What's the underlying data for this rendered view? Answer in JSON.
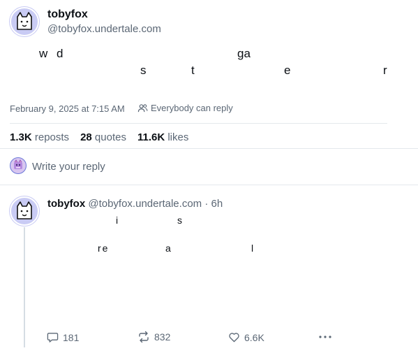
{
  "post": {
    "author": {
      "display_name": "tobyfox",
      "handle": "@tobyfox.undertale.com"
    },
    "text_chars": [
      {
        "char": "w",
        "line": 1
      },
      {
        "char": "d",
        "line": 1
      },
      {
        "char": "ga",
        "line": 1
      },
      {
        "char": "s",
        "line": 2
      },
      {
        "char": "t",
        "line": 2
      },
      {
        "char": "e",
        "line": 2
      },
      {
        "char": "r",
        "line": 2
      }
    ],
    "timestamp": "February 9, 2025 at 7:15 AM",
    "reply_setting": "Everybody can reply",
    "stats": {
      "reposts_count": "1.3K",
      "reposts_label": "reposts",
      "quotes_count": "28",
      "quotes_label": "quotes",
      "likes_count": "11.6K",
      "likes_label": "likes"
    }
  },
  "reply_box": {
    "placeholder": "Write your reply"
  },
  "reply": {
    "author": {
      "display_name": "tobyfox",
      "handle": "@tobyfox.undertale.com",
      "time": "6h"
    },
    "text_chars": [
      {
        "char": "i",
        "line": 1
      },
      {
        "char": "s",
        "line": 1
      },
      {
        "char": "re",
        "line": 2
      },
      {
        "char": "a",
        "line": 2
      },
      {
        "char": "l",
        "line": 2
      }
    ],
    "actions": {
      "replies": "181",
      "reposts": "832",
      "likes": "6.6K"
    }
  },
  "icons": {
    "avatar": "cat-face-icon",
    "reply_setting": "people-icon",
    "reply": "speech-bubble-icon",
    "repost": "repost-icon",
    "like": "heart-icon",
    "more": "more-dots-icon"
  },
  "colors": {
    "avatar_bg": "#c9cbf4",
    "muted_text": "#5b6775",
    "thread_line": "#d5dde4",
    "divider": "#e4e8ec"
  }
}
